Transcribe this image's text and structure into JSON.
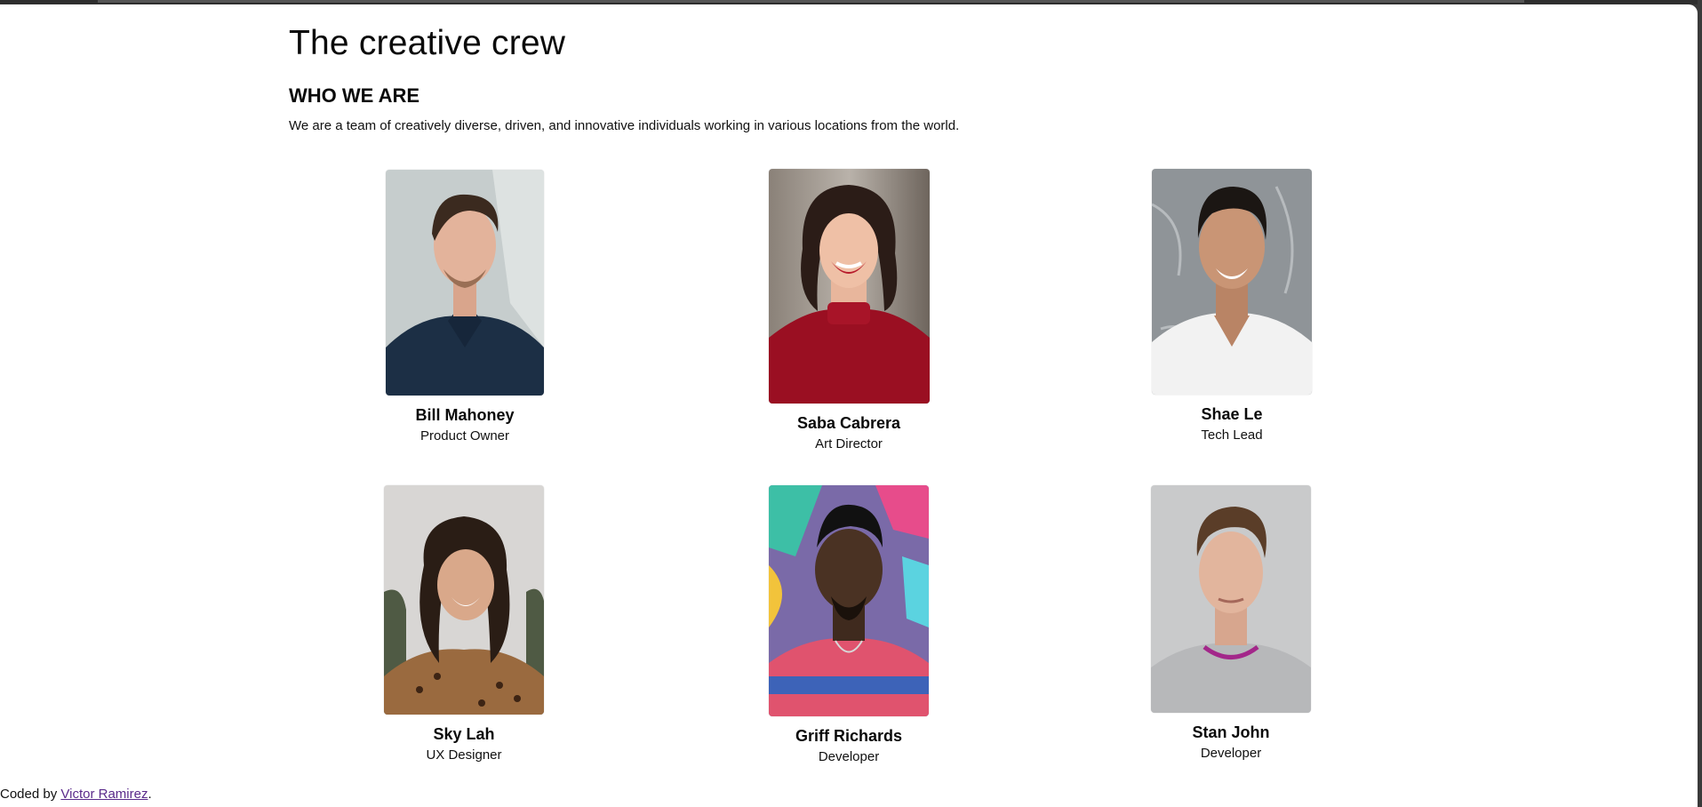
{
  "header": {
    "title": "The creative crew",
    "section_heading": "WHO WE ARE",
    "intro": "We are a team of creatively diverse, driven, and innovative individuals working in various locations from the world."
  },
  "team": [
    {
      "name": "Bill Mahoney",
      "role": "Product Owner",
      "photo_icon": "portrait-man-navy-polo"
    },
    {
      "name": "Saba Cabrera",
      "role": "Art Director",
      "photo_icon": "portrait-woman-red-sweater"
    },
    {
      "name": "Shae Le",
      "role": "Tech Lead",
      "photo_icon": "portrait-man-white-tee"
    },
    {
      "name": "Sky Lah",
      "role": "UX Designer",
      "photo_icon": "portrait-woman-leopard-top"
    },
    {
      "name": "Griff Richards",
      "role": "Developer",
      "photo_icon": "portrait-man-graffiti-background"
    },
    {
      "name": "Stan John",
      "role": "Developer",
      "photo_icon": "portrait-man-grey-sweater"
    }
  ],
  "footer": {
    "prefix": "Coded by",
    "author": "Victor Ramirez",
    "suffix": "."
  },
  "colors": {
    "page_background": "#ffffff",
    "chrome": "#3a3a3a",
    "link": "#5a2a8a"
  }
}
